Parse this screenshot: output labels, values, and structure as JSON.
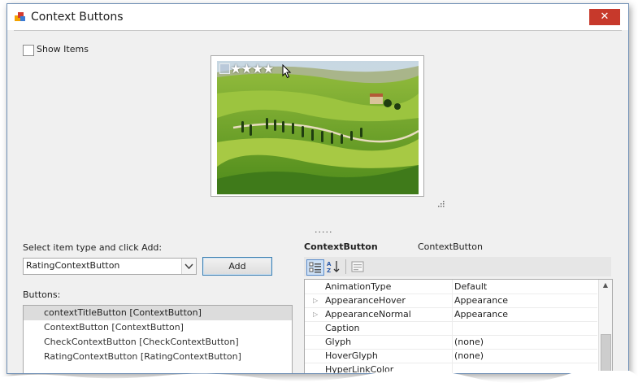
{
  "window": {
    "title": "Context Buttons",
    "close_glyph": "✕"
  },
  "options": {
    "show_items_label": "Show Items",
    "show_items_checked": false
  },
  "preview": {
    "rating_stars": "★★★★",
    "splitter_dots": "....."
  },
  "add_section": {
    "label": "Select item type and click Add:",
    "selected_type": "RatingContextButton",
    "add_label": "Add"
  },
  "buttons_list": {
    "label": "Buttons:",
    "items": [
      "contextTitleButton [ContextButton]",
      "ContextButton [ContextButton]",
      "CheckContextButton [CheckContextButton]",
      "RatingContextButton [RatingContextButton]"
    ],
    "selected_index": 0
  },
  "properties": {
    "object_name": "ContextButton",
    "object_type": "ContextButton",
    "rows": [
      {
        "name": "AnimationType",
        "value": "Default",
        "expandable": false
      },
      {
        "name": "AppearanceHover",
        "value": "Appearance",
        "expandable": true
      },
      {
        "name": "AppearanceNormal",
        "value": "Appearance",
        "expandable": true
      },
      {
        "name": "Caption",
        "value": "",
        "expandable": false
      },
      {
        "name": "Glyph",
        "value": "(none)",
        "expandable": false
      },
      {
        "name": "HoverGlyph",
        "value": "(none)",
        "expandable": false
      },
      {
        "name": "HyperLinkColor",
        "value": "",
        "expandable": false
      }
    ]
  },
  "colors": {
    "close_red": "#c7392b",
    "accent_blue": "#3c7fb1"
  }
}
